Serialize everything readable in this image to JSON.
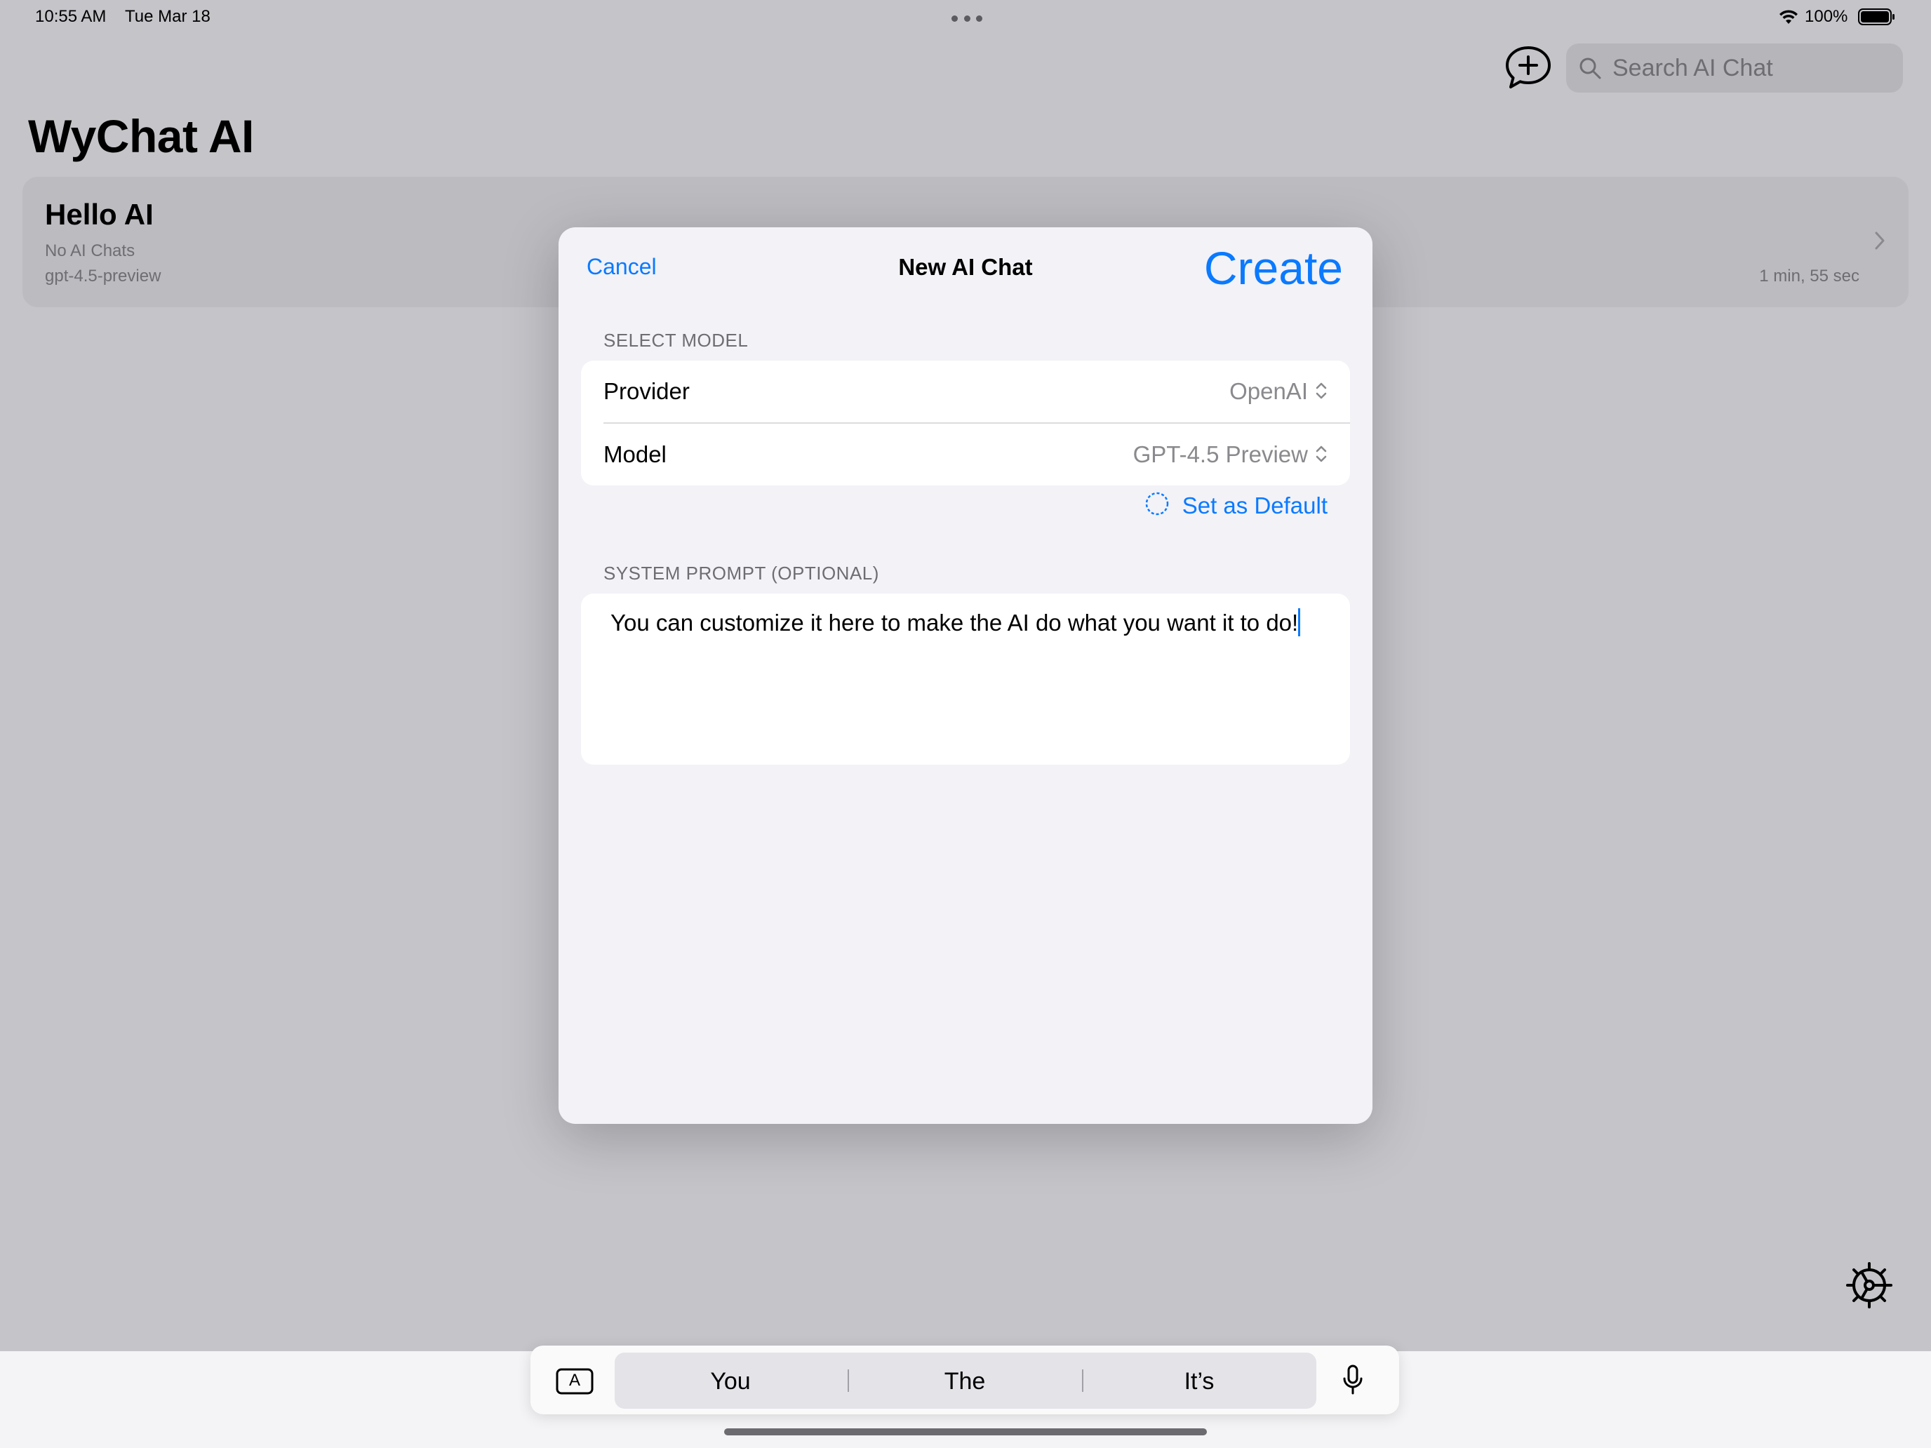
{
  "status_bar": {
    "time": "10:55 AM",
    "date": "Tue Mar 18",
    "battery": "100%"
  },
  "header": {
    "title": "WyChat AI",
    "search_placeholder": "Search AI Chat"
  },
  "chats": [
    {
      "name": "Hello AI",
      "subtitle": "No AI Chats",
      "model": "gpt-4.5-preview",
      "time": "1 min, 55 sec"
    }
  ],
  "modal": {
    "cancel": "Cancel",
    "title": "New AI Chat",
    "create": "Create",
    "select_model_label": "SELECT MODEL",
    "provider_label": "Provider",
    "provider_value": "OpenAI",
    "model_label": "Model",
    "model_value": "GPT-4.5 Preview",
    "set_default": "Set as Default",
    "system_prompt_label": "SYSTEM PROMPT (OPTIONAL)",
    "system_prompt": "You can customize it here to make the AI do what you want it to do!"
  },
  "keyboard": {
    "suggestions": [
      "You",
      "The",
      "It’s"
    ],
    "format_key": "A"
  },
  "colors": {
    "accent": "#0a7aff",
    "dim_background": "#c4c4c9",
    "modal_bg": "#f2f2f7"
  }
}
